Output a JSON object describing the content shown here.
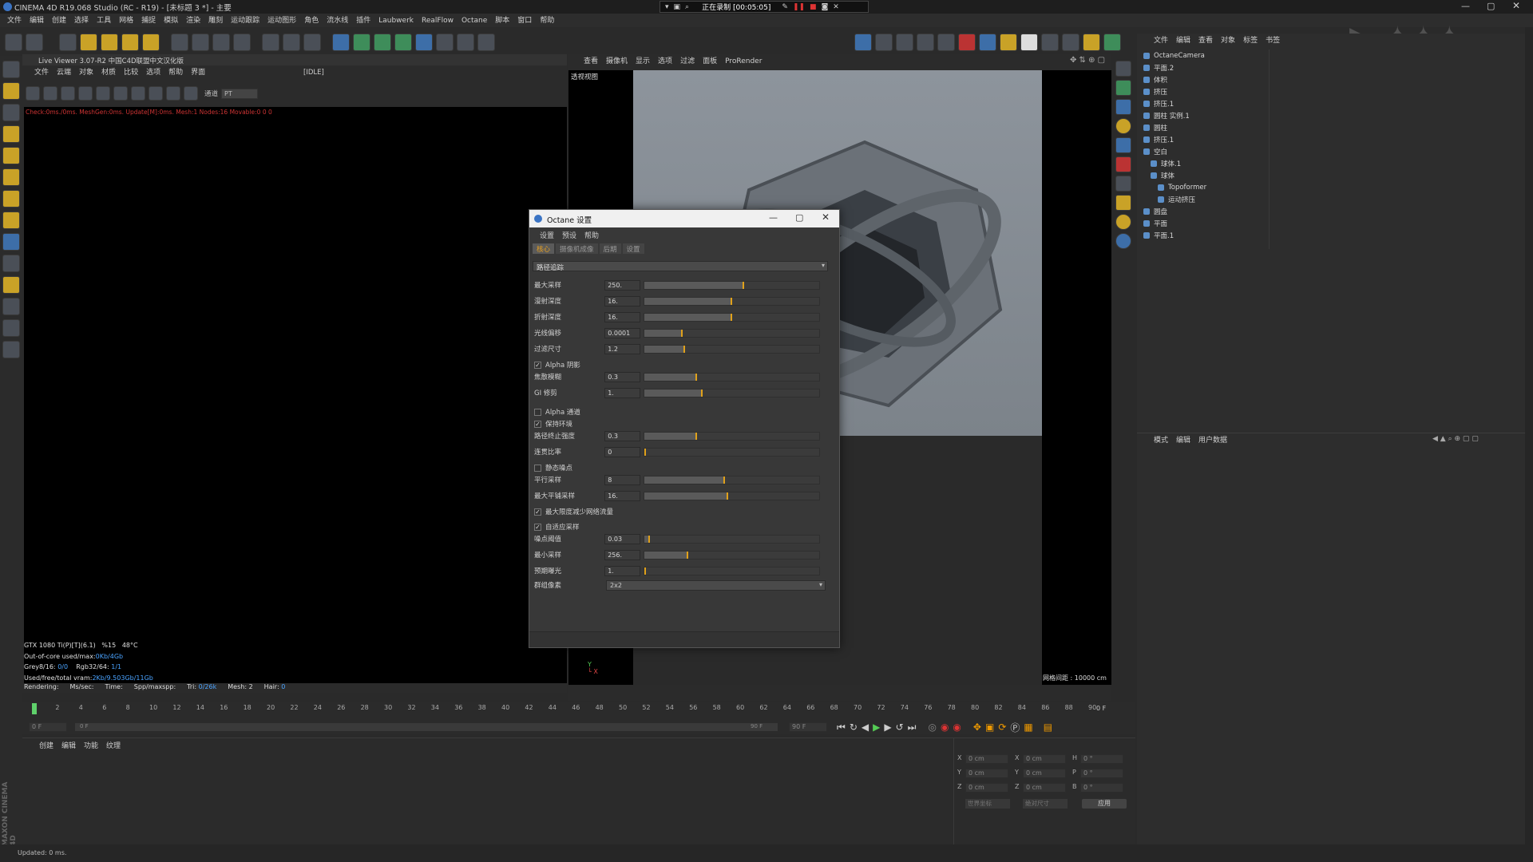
{
  "app": {
    "title": "CINEMA 4D R19.068 Studio (RC - R19) - [未标题 3 *] - 主要"
  },
  "recording": {
    "status": "正在录制 [00:05:05]"
  },
  "menu": [
    "文件",
    "编辑",
    "创建",
    "选择",
    "工具",
    "网格",
    "捕捉",
    "模拟",
    "渲染",
    "雕刻",
    "运动跟踪",
    "运动图形",
    "角色",
    "流水线",
    "插件",
    "Laubwerk",
    "RealFlow",
    "Octane",
    "脚本",
    "窗口",
    "帮助"
  ],
  "live_viewer": {
    "title": "Live Viewer 3.07-R2 中国C4D联盟中文汉化版",
    "menu": [
      "文件",
      "云端",
      "对象",
      "材质",
      "比较",
      "选项",
      "帮助",
      "界面"
    ],
    "status_tag": "[IDLE]",
    "channel_label": "通道",
    "channel_value": "PT",
    "log": "Check:0ms./0ms. MeshGen:0ms. Update[M]:0ms. Mesh:1 Nodes:16 Movable:0  0 0",
    "stats": {
      "gpu": "GTX 1080 Ti(P)[T](6.1)",
      "gpu_pct": "%15",
      "temp": "48°C",
      "out_of_core_label": "Out-of-core used/max:",
      "out_of_core_value": "0Kb/4Gb",
      "grey_label": "Grey8/16:",
      "grey_value": "0/0",
      "rgb_label": "Rgb32/64:",
      "rgb_value": "1/1",
      "vram_label": "Used/free/total vram:",
      "vram_value": "2Kb/9.503Gb/11Gb"
    },
    "render_bar": {
      "rendering": "Rendering:",
      "ms": "Ms/sec:",
      "time": "Time:",
      "spp": "Spp/maxspp:",
      "tri_label": "Tri:",
      "tri_value": "0/26k",
      "mesh_label": "Mesh:",
      "mesh_value": "2",
      "hair_label": "Hair:",
      "hair_value": "0"
    }
  },
  "viewport": {
    "menu": [
      "查看",
      "摄像机",
      "显示",
      "选项",
      "过滤",
      "面板",
      "ProRender"
    ],
    "name": "透视视图",
    "grid_label": "网格间距 : 10000 cm"
  },
  "dialog": {
    "title": "Octane 设置",
    "menu": [
      "设置",
      "预设",
      "帮助"
    ],
    "tabs": [
      "核心",
      "摄像机成像",
      "后期",
      "设置"
    ],
    "kernel": "路径追踪",
    "rows": [
      {
        "label": "最大采样",
        "value": "250.",
        "fill": 0.57
      },
      {
        "label": "漫射深度",
        "value": "16.",
        "fill": 0.5
      },
      {
        "label": "折射深度",
        "value": "16.",
        "fill": 0.5
      },
      {
        "label": "光线偏移",
        "value": "0.0001",
        "fill": 0.22
      },
      {
        "label": "过滤尺寸",
        "value": "1.2",
        "fill": 0.23
      },
      {
        "label": "焦散模糊",
        "value": "0.3",
        "fill": 0.3
      },
      {
        "label": "GI 修剪",
        "value": "1.",
        "fill": 0.33
      },
      {
        "label": "路径终止强度",
        "value": "0.3",
        "fill": 0.3
      },
      {
        "label": "连贯比率",
        "value": "0",
        "fill": 0.0
      },
      {
        "label": "平行采样",
        "value": "8",
        "fill": 0.46
      },
      {
        "label": "最大平铺采样",
        "value": "16.",
        "fill": 0.48
      },
      {
        "label": "噪点阈值",
        "value": "0.03",
        "fill": 0.03
      },
      {
        "label": "最小采样",
        "value": "256.",
        "fill": 0.25
      },
      {
        "label": "预期曝光",
        "value": "1.",
        "fill": 0.0
      }
    ],
    "checks": [
      {
        "label": "Alpha 阴影",
        "checked": true
      },
      {
        "label": "Alpha 通道",
        "checked": false
      },
      {
        "label": "保持环境",
        "checked": true
      },
      {
        "label": "静态噪点",
        "checked": false
      },
      {
        "label": "最大限度减少网络流量",
        "checked": true
      },
      {
        "label": "自适应采样",
        "checked": true
      }
    ],
    "group_label": "群组像素",
    "group_value": "2x2"
  },
  "object_manager": {
    "menu": [
      "文件",
      "编辑",
      "查看",
      "对象",
      "标签",
      "书签"
    ],
    "objects": [
      "OctaneCamera",
      "平面.2",
      "体积",
      "挤压",
      "挤压.1",
      "圆柱 实例.1",
      "圆柱",
      "挤压.1",
      "空白",
      "球体.1",
      "球体",
      "Topoformer",
      "运动挤压",
      "圆盘",
      "平面",
      "平面.1"
    ]
  },
  "attr_manager": {
    "menu": [
      "模式",
      "编辑",
      "用户数据"
    ]
  },
  "timeline": {
    "ticks": [
      "0",
      "2",
      "4",
      "6",
      "8",
      "10",
      "12",
      "14",
      "16",
      "18",
      "20",
      "22",
      "24",
      "26",
      "28",
      "30",
      "32",
      "34",
      "36",
      "38",
      "40",
      "42",
      "44",
      "46",
      "48",
      "50",
      "52",
      "54",
      "56",
      "58",
      "60",
      "62",
      "64",
      "66",
      "68",
      "70",
      "72",
      "74",
      "76",
      "78",
      "80",
      "82",
      "84",
      "86",
      "88",
      "90"
    ],
    "end_frame": "0 F",
    "start_field": "0 F",
    "cur_field": "0 F",
    "max_field": "90 F",
    "max2_field": "90 F"
  },
  "material_manager": {
    "menu": [
      "创建",
      "编辑",
      "功能",
      "纹理"
    ]
  },
  "coords": {
    "labels": [
      "X",
      "Y",
      "Z",
      "X",
      "Y",
      "Z",
      "H",
      "P",
      "B"
    ],
    "values": [
      "0 cm",
      "0 cm",
      "0 cm",
      "0 cm",
      "0 cm",
      "0 cm",
      "0 °",
      "0 °",
      "0 °"
    ],
    "apply": "应用",
    "mode1": "世界坐标",
    "mode2": "绝对尺寸"
  },
  "statusbar": "Updated: 0 ms."
}
